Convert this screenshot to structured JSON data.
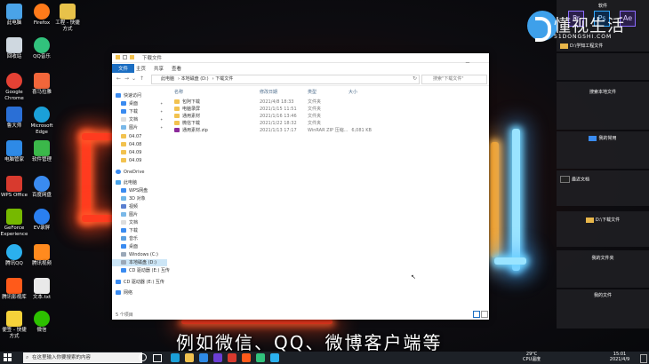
{
  "desktop": {
    "icons": [
      {
        "label": "此电脑",
        "color": "#4aa3e8"
      },
      {
        "label": "Firefox",
        "color": "#ff7a1a"
      },
      {
        "label": "工程 - 快捷方式",
        "color": "#e8c24a"
      },
      {
        "label": "回收站",
        "color": "#cfd8e0"
      },
      {
        "label": "QQ音乐",
        "color": "#31c27c"
      },
      {
        "label": "Google Chrome",
        "color": "#e44134"
      },
      {
        "label": "喜马拉雅",
        "color": "#f2663a"
      },
      {
        "label": "鲁大师",
        "color": "#2a6fd6"
      },
      {
        "label": "Microsoft Edge",
        "color": "#1ba0d8"
      },
      {
        "label": "电脑管家",
        "color": "#2e8ae6"
      },
      {
        "label": "软件管理",
        "color": "#3bb84a"
      },
      {
        "label": "WPS Office",
        "color": "#d83a2e"
      },
      {
        "label": "百度网盘",
        "color": "#3a8bf0"
      },
      {
        "label": "GeForce Experience",
        "color": "#76b900"
      },
      {
        "label": "EV录屏",
        "color": "#2a7ff0"
      },
      {
        "label": "腾讯QQ",
        "color": "#2bb0ee"
      },
      {
        "label": "腾讯视频",
        "color": "#ff8a1e"
      },
      {
        "label": "腾讯影视库",
        "color": "#ff5a1a"
      },
      {
        "label": "文本.txt",
        "color": "#e9e9e9"
      },
      {
        "label": "便签 - 快捷方式",
        "color": "#f5d23a"
      },
      {
        "label": "微信",
        "color": "#2dc100"
      }
    ]
  },
  "side_panel": {
    "header": "软件",
    "app_labels": [
      "Pr",
      "Ps",
      "Ae"
    ],
    "items": [
      {
        "label": "D:\\学知工程文件"
      },
      {
        "label": "搜索本地文件"
      },
      {
        "label": "我的常用"
      },
      {
        "label": "最近文档"
      },
      {
        "label": "D:\\下载文件"
      },
      {
        "label": "我的文件夹"
      },
      {
        "label": "我的文件"
      }
    ]
  },
  "logo": {
    "cn": "懂视生活",
    "en": "51DONGSHI.COM"
  },
  "explorer": {
    "title": "下载文件",
    "ribbon_tabs": [
      "文件",
      "主页",
      "共享",
      "查看"
    ],
    "window_buttons": [
      "—",
      "☐",
      "✕"
    ],
    "breadcrumb": [
      "此电脑",
      "本地磁盘 (D:)",
      "下载文件"
    ],
    "search_placeholder": "搜索\"下载文件\"",
    "nav": {
      "quick_access": "快速访问",
      "pinned": [
        "桌面",
        "下载",
        "文档",
        "图片"
      ],
      "recent": [
        "04.07",
        "04.08",
        "04.09",
        "04.09"
      ],
      "onedrive": "OneDrive",
      "this_pc": "此电脑",
      "pc_items": [
        "WPS网盘",
        "3D 对象",
        "视频",
        "图片",
        "文档",
        "下载",
        "音乐",
        "桌面",
        "Windows (C:)",
        "本地磁盘 (D:)",
        "CD 驱动器 (E:) 互传"
      ],
      "cd_drive": "CD 驱动器 (E:) 互传",
      "network": "网络"
    },
    "columns": [
      "名称",
      "修改日期",
      "类型",
      "大小"
    ],
    "files": [
      {
        "name": "包阿下载",
        "date": "2021/4/8 18:33",
        "type": "文件夹",
        "size": "",
        "zip": false
      },
      {
        "name": "电脑录屏",
        "date": "2021/1/15 11:51",
        "type": "文件夹",
        "size": "",
        "zip": false
      },
      {
        "name": "通用素材",
        "date": "2021/1/16 13:46",
        "type": "文件夹",
        "size": "",
        "zip": false
      },
      {
        "name": "微信下载",
        "date": "2021/1/22 18:32",
        "type": "文件夹",
        "size": "",
        "zip": false
      },
      {
        "name": "通用素材.zip",
        "date": "2021/1/13 17:17",
        "type": "WinRAR ZIP 压缩...",
        "size": "6,081 KB",
        "zip": true
      }
    ],
    "status": "5 个项目"
  },
  "subtitle": "例如微信、QQ、微博客户端等",
  "taskbar": {
    "search_placeholder": "在这里输入你要搜索的内容",
    "weather": "29°C",
    "weather_label": "CPU温度",
    "time": "15:01",
    "date": "2021/4/9",
    "apps": [
      "#1ba0d8",
      "#f2c24f",
      "#2e8ae6",
      "#6b3fd4",
      "#d83a2e",
      "#ff5a1a",
      "#31c27c",
      "#2bb0ee"
    ]
  }
}
